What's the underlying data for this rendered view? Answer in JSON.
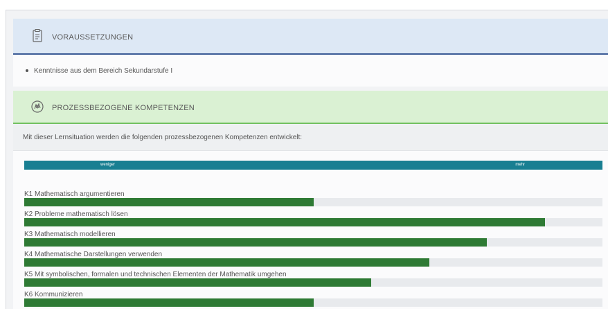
{
  "sections": {
    "requirements": {
      "title": "VORAUSSETZUNGEN",
      "icon": "clipboard-icon",
      "items": [
        "Kenntnisse aus dem Bereich Sekundarstufe I"
      ]
    },
    "competencies": {
      "title": "PROZESSBEZOGENE KOMPETENZEN",
      "icon": "hand-gear-icon",
      "intro": "Mit dieser Lernsituation werden die folgenden prozessbezogenen Kompetenzen entwickelt:",
      "scale": {
        "low": "weniger",
        "high": "mehr"
      },
      "items": [
        {
          "label": "K1 Mathematisch argumentieren",
          "level": 0.5
        },
        {
          "label": "K2 Probleme mathematisch lösen",
          "level": 0.9
        },
        {
          "label": "K3 Mathematisch modellieren",
          "level": 0.8
        },
        {
          "label": "K4 Mathematische Darstellungen verwenden",
          "level": 0.7
        },
        {
          "label": "K5 Mit symbolischen, formalen und technischen Elementen der Mathematik umgehen",
          "level": 0.6
        },
        {
          "label": "K6 Kommunizieren",
          "level": 0.5
        }
      ]
    }
  },
  "colors": {
    "blue_header": "#dde8f5",
    "blue_rule": "#3a5a95",
    "green_header": "#daf1d3",
    "green_rule": "#72c060",
    "scale_bar": "#197f92",
    "level_fill": "#2e7a34"
  }
}
